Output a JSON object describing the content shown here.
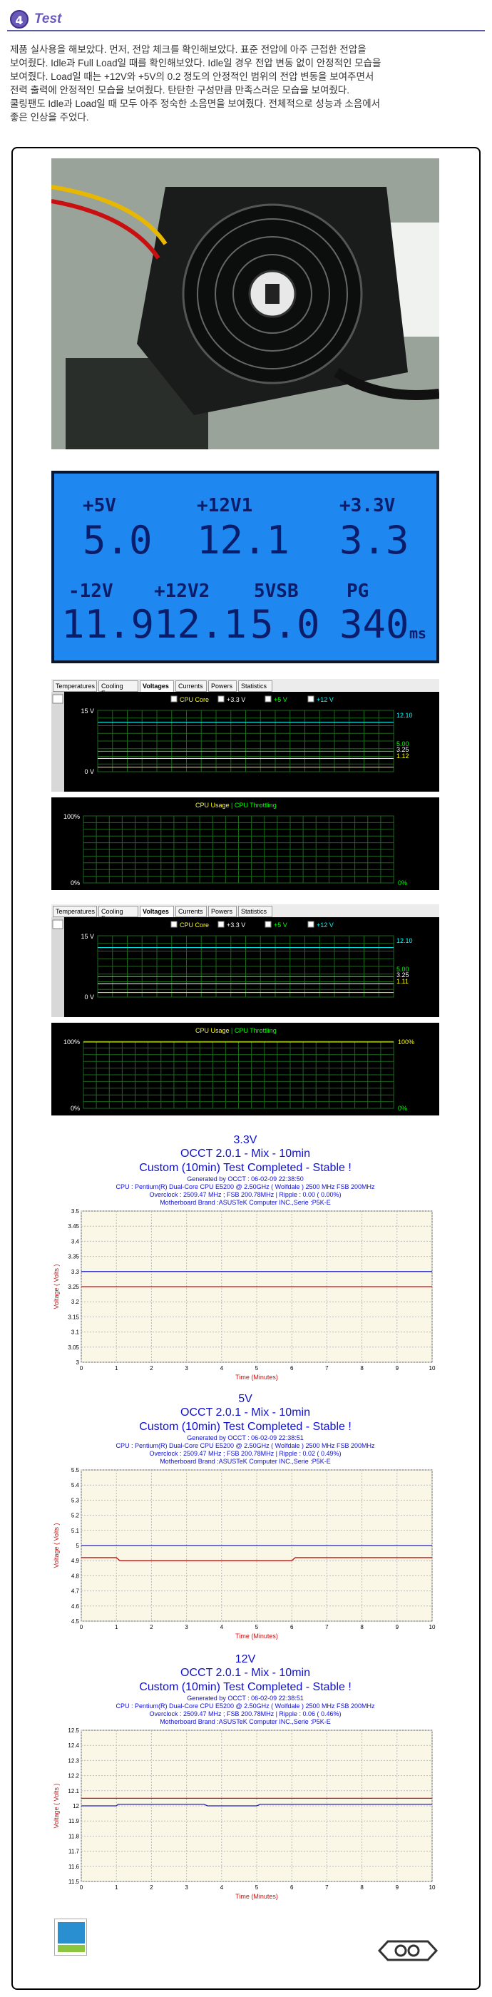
{
  "header": {
    "number": "4",
    "title": "Test"
  },
  "intro": [
    "제품 실사용을 해보았다. 먼저, 전압 체크를 확인해보았다. 표준 전압에 아주 근접한 전압을",
    "보여줬다. Idle과 Full Load일 때를 확인해보았다. Idle일 경우 전압 변동 없이 안정적인 모습을",
    "보여줬다. Load일 때는 +12V와 +5V의 0.2 정도의 안정적인 범위의 전압 변동을 보여주면서",
    "전력 출력에 안정적인 모습을 보여줬다. 탄탄한 구성만큼  만족스러운 모습을 보여줬다.",
    "쿨링팬도 Idle과 Load일 때 모두 아주 정숙한 소음면을 보여줬다. 전체적으로 성능과 소음에서",
    "좋은 인상을 주었다."
  ],
  "lcd": {
    "labels": [
      "+5V",
      "+12V1",
      "+3.3V",
      "-12V",
      "+12V2",
      "5VSB",
      "PG"
    ],
    "values": [
      "5.0",
      "12.1",
      "3.3",
      "11.9",
      "12.1",
      "5.0",
      "340"
    ],
    "unit": "ms"
  },
  "colors": {
    "accent": "#6a5ab8",
    "occt_text": "#1010d0",
    "lcd_bg": "#1e88f0",
    "grid_green": "#1a6a1a",
    "cpu_core": "#ffff00",
    "v33": "#ffffff",
    "v5": "#00ff00",
    "v12": "#00ffff",
    "occt_red": "#c81010"
  },
  "monitors": [
    {
      "tabs": [
        "Temperatures",
        "Cooling Fans",
        "Voltages",
        "Currents",
        "Powers",
        "Statistics"
      ],
      "selected_tab": "Voltages",
      "legend": [
        "CPU Core",
        "+3.3 V",
        "+5 V",
        "+12 V"
      ],
      "y_top": "15 V",
      "y_bottom": "0 V",
      "readings": [
        "12.10",
        "5.00",
        "3.25",
        "1.12"
      ],
      "usage_legend": [
        "CPU Usage",
        "CPU Throttling"
      ],
      "usage_top": "100%",
      "usage_bottom": "0%",
      "usage_right_top": "",
      "usage_right_bottom": "0%"
    },
    {
      "tabs": [
        "Temperatures",
        "Cooling Fans",
        "Voltages",
        "Currents",
        "Powers",
        "Statistics"
      ],
      "selected_tab": "Voltages",
      "legend": [
        "CPU Core",
        "+3.3 V",
        "+5 V",
        "+12 V"
      ],
      "y_top": "15 V",
      "y_bottom": "0 V",
      "readings": [
        "12.10",
        "5.00",
        "3.25",
        "1.11"
      ],
      "usage_legend": [
        "CPU Usage",
        "CPU Throttling"
      ],
      "usage_top": "100%",
      "usage_bottom": "0%",
      "usage_right_top": "100%",
      "usage_right_bottom": "0%"
    }
  ],
  "chart_data": [
    {
      "type": "line",
      "title": "3.3V",
      "heading": [
        "OCCT 2.0.1 - Mix - 10min",
        "Custom (10min) Test Completed - Stable !"
      ],
      "info": [
        "Generated by OCCT : 06-02-09 22:38:50",
        "CPU : Pentium(R) Dual-Core CPU E5200 @ 2.50GHz ( Wolfdale ) 2500 MHz FSB 200MHz",
        "Overclock : 2509.47 MHz ; FSB 200.78MHz | Ripple : 0.00 ( 0.00%)",
        "Motherboard Brand :ASUSTeK Computer INC.,Serie :P5K-E"
      ],
      "xlabel": "Time (Minutes)",
      "ylabel": "Voltage ( Volts )",
      "xlim": [
        0,
        10
      ],
      "ylim": [
        3,
        3.5
      ],
      "yticks": [
        "3",
        "3.05",
        "3.1",
        "3.15",
        "3.2",
        "3.25",
        "3.3",
        "3.35",
        "3.4",
        "3.45",
        "3.5"
      ],
      "xticks": [
        "0",
        "1",
        "2",
        "3",
        "4",
        "5",
        "6",
        "7",
        "8",
        "9",
        "10"
      ],
      "series": [
        {
          "color": "#2020c0",
          "x": [
            0,
            10
          ],
          "y": [
            3.3,
            3.3
          ]
        },
        {
          "color": "#c81010",
          "x": [
            0,
            10
          ],
          "y": [
            3.25,
            3.25
          ]
        }
      ]
    },
    {
      "type": "line",
      "title": "5V",
      "heading": [
        "OCCT 2.0.1 - Mix - 10min",
        "Custom (10min) Test Completed - Stable !"
      ],
      "info": [
        "Generated by OCCT : 06-02-09 22:38:51",
        "CPU : Pentium(R) Dual-Core CPU E5200 @ 2.50GHz ( Wolfdale ) 2500 MHz FSB 200MHz",
        "Overclock : 2509.47 MHz ; FSB 200.78MHz | Ripple : 0.02 ( 0.49%)",
        "Motherboard Brand :ASUSTeK Computer INC.,Serie :P5K-E"
      ],
      "xlabel": "Time (Minutes)",
      "ylabel": "Voltage ( Volts )",
      "xlim": [
        0,
        10
      ],
      "ylim": [
        4.5,
        5.5
      ],
      "yticks": [
        "4.5",
        "4.6",
        "4.7",
        "4.8",
        "4.9",
        "5",
        "5.1",
        "5.2",
        "5.3",
        "5.4",
        "5.5"
      ],
      "xticks": [
        "0",
        "1",
        "2",
        "3",
        "4",
        "5",
        "6",
        "7",
        "8",
        "9",
        "10"
      ],
      "series": [
        {
          "color": "#2020c0",
          "x": [
            0,
            10
          ],
          "y": [
            5.0,
            5.0
          ]
        },
        {
          "color": "#c81010",
          "x": [
            0,
            1.0,
            1.1,
            6.0,
            6.1,
            10
          ],
          "y": [
            4.92,
            4.92,
            4.9,
            4.9,
            4.92,
            4.92
          ]
        }
      ]
    },
    {
      "type": "line",
      "title": "12V",
      "heading": [
        "OCCT 2.0.1 - Mix - 10min",
        "Custom (10min) Test Completed - Stable !"
      ],
      "info": [
        "Generated by OCCT : 06-02-09 22:38:51",
        "CPU : Pentium(R) Dual-Core CPU E5200 @ 2.50GHz ( Wolfdale ) 2500 MHz FSB 200MHz",
        "Overclock : 2509.47 MHz ; FSB 200.78MHz | Ripple : 0.06 ( 0.46%)",
        "Motherboard Brand :ASUSTeK Computer INC.,Serie :P5K-E"
      ],
      "xlabel": "Time (Minutes)",
      "ylabel": "Voltage ( Volts )",
      "xlim": [
        0,
        10
      ],
      "ylim": [
        11.5,
        12.5
      ],
      "yticks": [
        "11.5",
        "11.6",
        "11.7",
        "11.8",
        "11.9",
        "12",
        "12.1",
        "12.2",
        "12.3",
        "12.4",
        "12.5"
      ],
      "xticks": [
        "0",
        "1",
        "2",
        "3",
        "4",
        "5",
        "6",
        "7",
        "8",
        "9",
        "10"
      ],
      "series": [
        {
          "color": "#c81010",
          "x": [
            0,
            10
          ],
          "y": [
            12.05,
            12.05
          ]
        },
        {
          "color": "#2020c0",
          "x": [
            0,
            1,
            1.05,
            3.5,
            3.6,
            5.0,
            5.1,
            10
          ],
          "y": [
            12.0,
            12.0,
            12.01,
            12.01,
            12.0,
            12.0,
            12.01,
            12.01
          ]
        }
      ]
    }
  ]
}
